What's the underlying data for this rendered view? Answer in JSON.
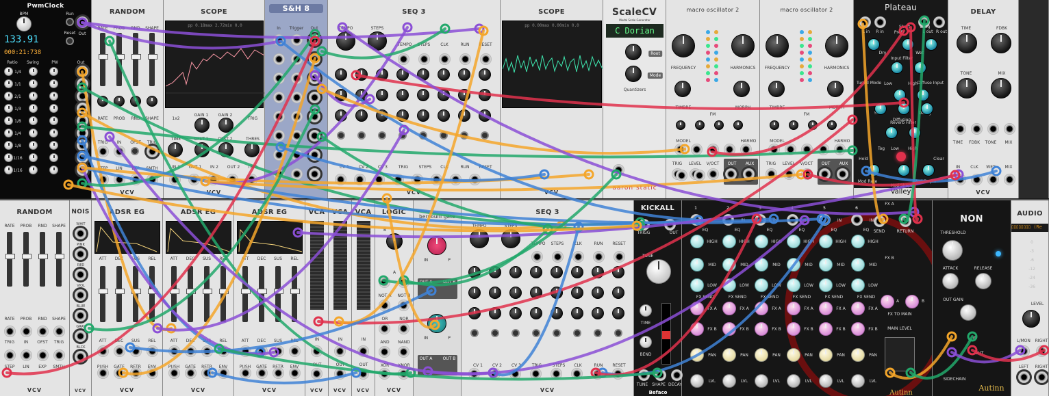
{
  "modules": {
    "pwmclock": {
      "title": "PwmClock",
      "bpm_label": "BPM",
      "run": "Run",
      "reset": "Reset",
      "out": "Out",
      "bpm": "133.91",
      "time": "000:21:738",
      "col_ratio": "Ratio",
      "col_swing": "Swing",
      "col_pw": "PW",
      "col_out": "Out",
      "ratios": [
        "1/4",
        "1/1",
        "2/1",
        "1/3",
        "1/8",
        "1/4",
        "1/8",
        "1/16",
        "1/16"
      ]
    },
    "random1": {
      "title": "RANDOM",
      "labels": [
        "RATE",
        "PROB",
        "RND",
        "SHAPE"
      ],
      "mid": [
        "RATE",
        "PROB",
        "RND",
        "SHAPE"
      ],
      "trig": [
        "TRIG",
        "IN",
        "OFST",
        "TRIG"
      ],
      "outs": [
        "STEP",
        "LIN",
        "EXP",
        "SMTH"
      ],
      "brand": "VCV"
    },
    "scope1": {
      "title": "SCOPE",
      "readout": "pp  0.18max  2.72min  0.0",
      "l1": "1x2",
      "l2": "GAIN 1",
      "l3": "GAIN 2",
      "l4": "TRIG",
      "l5": "TIME",
      "l6": "OFST 1",
      "l7": "OFST 2",
      "l8": "THRES",
      "o": [
        "IN 1",
        "OUT 1",
        "IN 2",
        "OUT 2",
        "TRIG"
      ],
      "brand": "VCV"
    },
    "sh8": {
      "title": "S&H 8",
      "h": [
        "In",
        "Trigger",
        "Out"
      ]
    },
    "seq3a": {
      "title": "SEQ 3",
      "tempo": "TEMPO",
      "steps": "STEPS",
      "tempo2": "TEMPO",
      "steps2": "STEPS",
      "clk": "CLK",
      "run": "RUN",
      "reset": "RESET",
      "outs": [
        "CV 1",
        "CV 2",
        "CV 3",
        "TRIG",
        "STEPS",
        "CLK",
        "RUN",
        "RESET"
      ],
      "brand": "VCV"
    },
    "scope2": {
      "title": "SCOPE",
      "readout": "pp  0.00max  0.00min  0.0",
      "brand": "VCV"
    },
    "scalecv": {
      "title": "ScaleCV",
      "sub": "Modal Scale Generator",
      "display": "C Dorian",
      "root": "Root",
      "mode": "Mode",
      "quant": "Quantizers",
      "brand": "aaron static"
    },
    "macro1": {
      "title": "macro oscillator 2",
      "freq": "FREQUENCY",
      "harm": "HARMONICS",
      "timbre": "TIMBRE",
      "fm": "FM",
      "morph": "MORPH",
      "harmo": "HARMO",
      "model": "MODEL",
      "outs": [
        "TRIG",
        "LEVEL",
        "V/OCT",
        "OUT",
        "AUX"
      ]
    },
    "macro2": {
      "title": "macro oscillator 2",
      "freq": "FREQUENCY",
      "harm": "HARMONICS",
      "timbre": "TIMBRE",
      "fm": "FM",
      "morph": "MORPH",
      "harmo": "HARMO",
      "model": "MODEL",
      "outs": [
        "TRIG",
        "LEVEL",
        "V/OCT",
        "OUT",
        "AUX"
      ]
    },
    "plateau": {
      "title": "Plateau",
      "l": [
        "L in",
        "R in",
        "Short",
        "PreD",
        "Long",
        "L out",
        "R out",
        "Dry",
        "Wet",
        "Input Filter",
        "Low",
        "High",
        "Tuned Mode",
        "Diffuse Input",
        "Size",
        "Decay",
        "Diffusion",
        "Reverb Filter",
        "Low",
        "High",
        "Tog",
        "Hold",
        "Clear",
        "Mod Rate",
        "Mod Shape",
        "Mod Depth"
      ],
      "valley": "Valley"
    },
    "delay": {
      "title": "DELAY",
      "time": "TIME",
      "fdbk": "FDBK",
      "tone": "TONE",
      "mix": "MIX",
      "l2": [
        "TIME",
        "FDBK",
        "TONE",
        "MIX"
      ],
      "o": [
        "IN",
        "CLK",
        "WET",
        "MIX"
      ],
      "brand": "VCV"
    },
    "random2": {
      "title": "RANDOM",
      "labels": [
        "RATE",
        "PROB",
        "RND",
        "SHAPE"
      ],
      "trig": [
        "TRIG",
        "IN",
        "OFST",
        "TRIG"
      ],
      "outs": [
        "STEP",
        "LIN",
        "EXP",
        "SMTH"
      ],
      "brand": "VCV"
    },
    "noise": {
      "title": "NOIS",
      "cols": [
        "WHIT",
        "PINK",
        "RED",
        "VIOL",
        "BLUE",
        "GRAY",
        "BLCK"
      ],
      "brand": "VCV"
    },
    "adsr1": {
      "title": "ADSR EG",
      "l": [
        "ATT",
        "DEC",
        "SUS",
        "REL"
      ],
      "o": [
        "PUSH",
        "GATE",
        "RETR",
        "ENV"
      ],
      "brand": "VCV"
    },
    "adsr2": {
      "title": "ADSR EG",
      "l": [
        "ATT",
        "DEC",
        "SUS",
        "REL"
      ],
      "o": [
        "PUSH",
        "GATE",
        "RETR",
        "ENV"
      ],
      "brand": "VCV"
    },
    "adsr3": {
      "title": "ADSR EG",
      "l": [
        "ATT",
        "DEC",
        "SUS",
        "REL"
      ],
      "o": [
        "PUSH",
        "GATE",
        "RETR",
        "ENV"
      ],
      "brand": "VCV"
    },
    "vca1": {
      "title": "VCA",
      "in": "IN",
      "out": "OUT",
      "brand": "VCV"
    },
    "vca2": {
      "title": "VCA",
      "in": "IN",
      "out": "OUT",
      "brand": "VCV"
    },
    "vca3": {
      "title": "VCA",
      "in": "IN",
      "out": "OUT",
      "brand": "VCV"
    },
    "logic": {
      "title": "LOGIC",
      "b": "B",
      "a": "A",
      "gates": [
        "NOT A",
        "NOT B",
        "OR",
        "NOR",
        "AND",
        "NAND",
        "XOR",
        "XNOR"
      ],
      "brand": "VCV"
    },
    "bernoulli": {
      "title": "bernoulli gate",
      "in": "IN",
      "p": "P",
      "outa": "OUT A",
      "outb": "OUT B"
    },
    "seq3b": {
      "title": "SEQ 3",
      "tempo": "TEMPO",
      "steps": "STEPS",
      "clk": "CLK",
      "run": "RUN",
      "reset": "RESET",
      "outs": [
        "CV 1",
        "CV 2",
        "CV 3",
        "TRIG",
        "STEPS",
        "CLK",
        "RUN",
        "RESET"
      ],
      "brand": "VCV"
    },
    "kickall": {
      "title": "KICKALL",
      "trig": "TRIGG",
      "out": "OUT",
      "tune": "TUNE",
      "time": "TIME",
      "bend": "BEND",
      "outs": [
        "TUNE",
        "SHAPE",
        "DECAY"
      ],
      "brand": "Befaco"
    },
    "mixer": {
      "ch": [
        "1",
        "2",
        "3",
        "4",
        "5",
        "6"
      ],
      "in": "IN",
      "eq": "EQ",
      "high": "HIGH",
      "mid": "MID",
      "low": "LOW",
      "fxsend": "FX SEND",
      "fxa": "FX A",
      "fxb": "FX B",
      "pan": "PAN",
      "lvl": "LVL",
      "fxa_h": "FX A",
      "send": "SEND",
      "ret": "RETURN",
      "fxb_h": "FX B",
      "a": "A",
      "b": "B",
      "fxmain": "FX TO MAIN",
      "main": "MAIN LEVEL",
      "brand": "Autinn"
    },
    "non": {
      "title": "NON",
      "threshold": "THRESHOLD",
      "attack": "ATTACK",
      "release": "RELEASE",
      "outgain": "OUT GAIN",
      "in": "IN",
      "out": "OUT",
      "side": "SIDECHAIN",
      "brand": "Autinn"
    },
    "audio": {
      "title": "AUDIO",
      "dev": "ﾛﾛﾛﾛﾛﾛﾛﾛ (Re",
      "level": "LEVEL",
      "lmon": "L/MON",
      "right": "RIGHT",
      "left": "LEFT",
      "right2": "RIGHT",
      "meter": [
        "0",
        "-3",
        "-6",
        "-12",
        "-24",
        "-36"
      ]
    }
  },
  "cable_colors": {
    "orange": "#f4a62a",
    "green": "#22a86b",
    "blue": "#3f82d6",
    "purple": "#8b4fd6",
    "red": "#e0314c"
  }
}
